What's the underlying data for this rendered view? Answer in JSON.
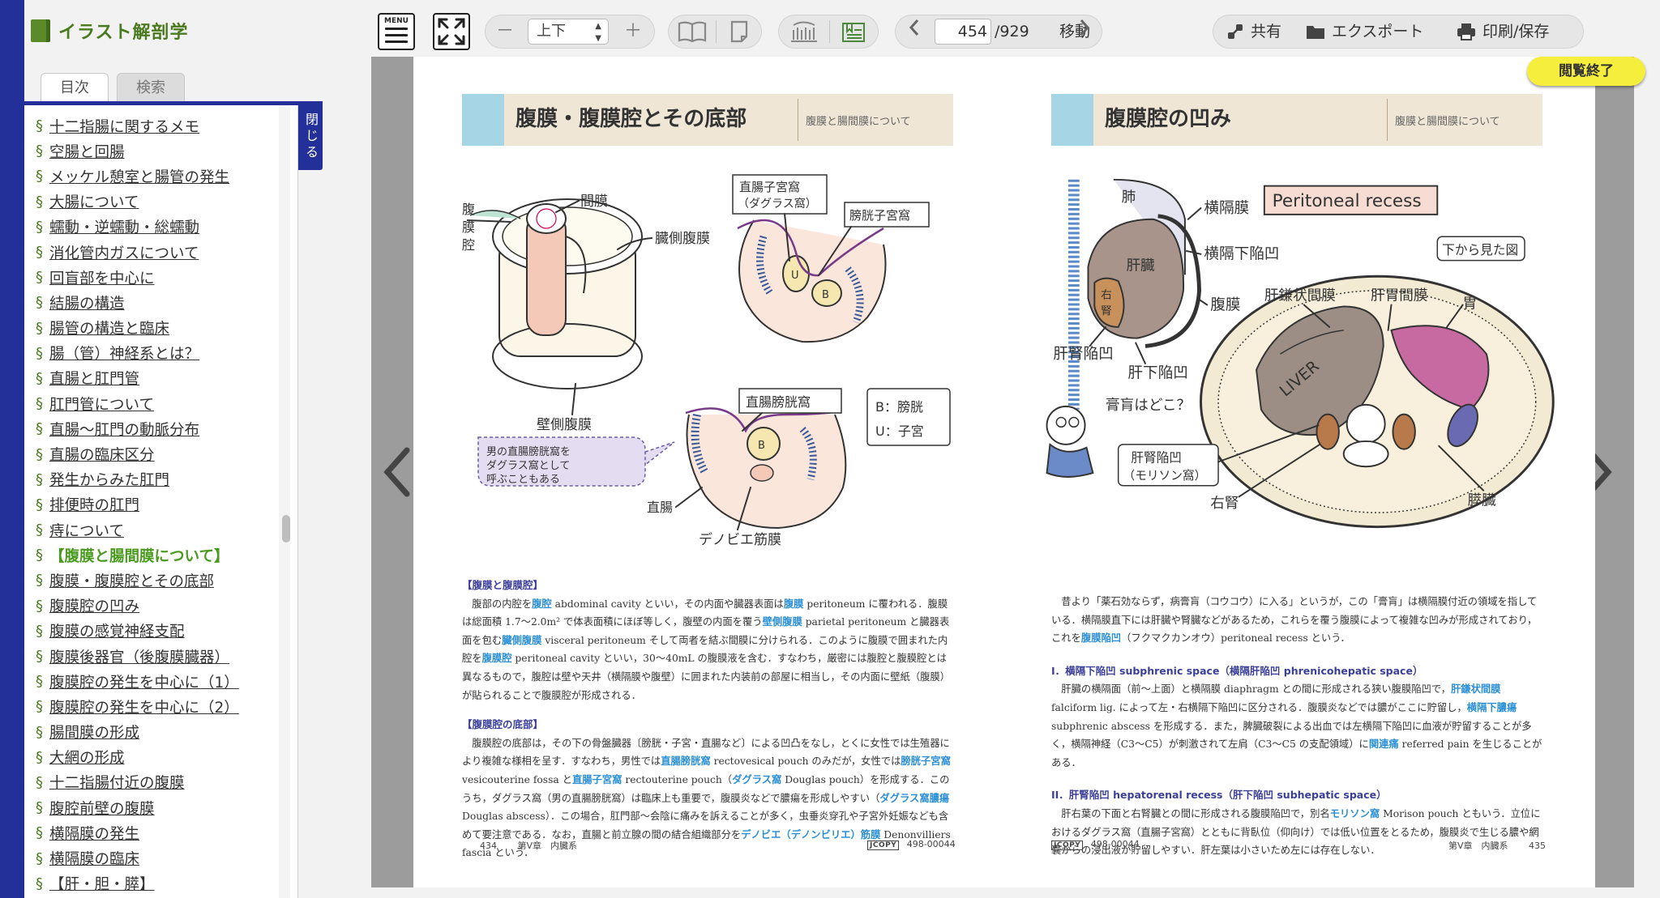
{
  "sidebar": {
    "app_title": "イラスト解剖学",
    "tabs": {
      "toc": "目次",
      "search": "検索"
    },
    "close_label": "閉じる",
    "toc_items": [
      "十二指腸に関するメモ",
      "空腸と回腸",
      "メッケル憩室と腸管の発生",
      "大腸について",
      "蠕動・逆蠕動・総蠕動",
      "消化管内ガスについて",
      "回盲部を中心に",
      "結腸の構造",
      "腸管の構造と臨床",
      "腸（管）神経系とは？",
      "直腸と肛門管",
      "肛門管について",
      "直腸～肛門の動脈分布",
      "直腸の臨床区分",
      "発生からみた肛門",
      "排便時の肛門",
      "痔について",
      "【腹膜と腸間膜について】",
      "腹膜・腹膜腔とその底部",
      "腹膜腔の凹み",
      "腹膜の感覚神経支配",
      "腹膜後器官（後腹膜臓器）",
      "腹膜腔の発生を中心に（1）",
      "腹膜腔の発生を中心に（2）",
      "腸間膜の形成",
      "大網の形成",
      "十二指腸付近の腹膜",
      "腹腔前壁の腹膜",
      "横隔膜の発生",
      "横隔膜の臨床",
      "【肝・胆・膵】"
    ],
    "active_index": 17,
    "section_mark": "§"
  },
  "toolbar": {
    "menu_label": "MENU",
    "direction_value": "上下",
    "minus_label": "－",
    "plus_label": "＋",
    "page_current": "454",
    "page_total": "/929",
    "goto_label": "移動",
    "share_label": "共有",
    "export_label": "エクスポート",
    "print_label": "印刷/保存"
  },
  "viewer": {
    "end_label": "閲覧終了"
  },
  "left_page": {
    "title": "腹膜・腹膜腔とその底部",
    "subtitle": "腹膜と腸間膜について",
    "labels": {
      "mesentery": "間膜",
      "cavity": "腹膜腔",
      "visceral": "臓側腹膜",
      "parietal": "壁側腹膜",
      "douglas": "直腸子宮窩（ダグラス窩）",
      "vesico_uterine": "膀胱子宮窩",
      "recto_vesical": "直腸膀胱窩",
      "legend_b": "B：膀胱",
      "legend_u": "U：子宮",
      "rectum": "直腸",
      "denon": "デノビエ筋膜",
      "bubble": "男の直腸膀胱窩をダグラス窩として呼ぶこともある",
      "u": "U",
      "b": "B"
    },
    "sections": [
      {
        "head": "【腹膜と腹膜腔】",
        "body": "腹部の内腔を腹腔 abdominal cavity といい，その内面や臓器表面は腹膜 peritoneum に覆われる．腹膜は総面積 1.7～2.0m² で体表面積にほぼ等しく，腹壁の内面を覆う壁側腹膜 parietal peritoneum と臓器表面を包む臓側腹膜 visceral peritoneum そして両者を結ぶ間膜に分けられる．このように腹膜で囲まれた内腔を腹膜腔 peritoneal cavity といい，30～40mL の腹膜液を含む．すなわち，厳密には腹腔と腹膜腔とは異なるもので，腹腔は壁や天井（横隔膜や腹壁）に囲まれた内装前の部屋に相当し，その内面に壁紙（腹膜）が貼られることで腹膜腔が形成される．"
      },
      {
        "head": "【腹膜腔の底部】",
        "body": "腹膜腔の底部は，その下の骨盤臓器〔膀胱・子宮・直腸など〕による凹凸をなし，とくに女性では生殖器により複雑な様相を呈す．すなわち，男性では直腸膀胱窩 rectovesical pouch のみだが，女性では膀胱子宮窩 vesicouterine fossa と直腸子宮窩 rectouterine pouch（ダグラス窩 Douglas pouch）を形成する．このうち，ダグラス窩（男の直腸膀胱窩）は臨床上も重要で，腹膜炎などで膿瘍を形成しやすい（ダグラス窩膿瘍 Douglas abscess）．この場合，肛門部～会陰に痛みを訴えることが多く，虫垂炎穿孔や子宮外妊娠なども含めて要注意である．なお，直腸と前立腺の間の結合組織部分をデノビエ（デノンビリエ）筋膜 Denonvilliers fascia という．"
      }
    ],
    "footer": {
      "page_no": "434",
      "chapter": "第V章　内臓系",
      "jcopy": "JCOPY",
      "code": "498-00044"
    }
  },
  "right_page": {
    "title": "腹膜腔の凹み",
    "subtitle": "腹膜と腸間膜について",
    "labels": {
      "lung": "肺",
      "diaphragm": "横隔膜",
      "subphrenic": "横隔下陥凹",
      "liver": "肝臓",
      "right_kidney": "右腎",
      "peritoneum": "腹膜",
      "hepatorenal": "肝腎陥凹",
      "subhepatic": "肝下陥凹",
      "recess_title": "Peritoneal recess",
      "view_from_below": "下から見た図",
      "falciform": "肝鎌状間膜",
      "hepatogastric": "肝胃間膜",
      "stomach": "胃",
      "liver_en": "LIVER",
      "question": "膏肓はどこ？",
      "morison": "肝腎陥凹（モリソン窩）",
      "kidney_r": "右腎",
      "pancreas": "膵臓"
    },
    "intro": "昔より「薬石効ならず，病膏肓（コウコウ）に入る」というが，この「膏肓」は横隔膜付近の領域を指している．横隔膜直下には肝臓や腎臓などがあるため，これらを覆う腹膜によって複雑な凹みが形成されており，これを腹膜陥凹（フクマクカンオウ）peritoneal recess という．",
    "sections": [
      {
        "head": "I．横隔下陥凹 subphrenic space（横隔肝陥凹 phrenicohepatic space）",
        "body": "肝臓の横隔面（前～上面）と横隔膜 diaphragm との間に形成される狭い腹膜陥凹で，肝鎌状間膜 falciform lig. によって左・右横隔下陥凹に区分される．腹膜炎などでは膿がここに貯留し，横隔下膿瘍 subphrenic abscess を形成する．また，脾臓破裂による出血では左横隔下陥凹に血液が貯留することが多く，横隔神経（C3～C5）が刺激されて左肩（C3～C5 の支配領域）に関連痛 referred pain を生じることがある．"
      },
      {
        "head": "II．肝腎陥凹 hepatorenal recess（肝下陥凹 subhepatic space）",
        "body": "肝右葉の下面と右腎臓との間に形成される腹膜陥凹で，別名モリソン窩 Morison pouch ともいう．立位におけるダグラス窩（直腸子宮窩）とともに背臥位（仰向け）では低い位置をとるため，腹膜炎で生じる膿や網嚢からの浸出液が貯留しやすい．肝左葉は小さいため左には存在しない．"
      }
    ],
    "footer": {
      "page_no": "435",
      "chapter": "第V章　内臓系",
      "jcopy": "JCOPY",
      "code": "498-00044"
    }
  },
  "colors": {
    "sidebar_blue": "#23309a",
    "toc_green": "#4a7a1e",
    "header_blue": "#a6d6e6",
    "header_beige": "#efe6d5",
    "highlight_blue": "#2b8fd6",
    "end_button_yellow": "#f6ee3c"
  },
  "icons": {
    "menu": "menu-icon",
    "fullscreen": "fullscreen-icon",
    "book_open": "open-book-icon",
    "single_page": "single-page-icon",
    "thumbnails": "thumbnails-icon",
    "bookmarks": "bookmark-list-icon",
    "prev": "chevron-left-icon",
    "next": "chevron-right-icon",
    "share": "share-icon",
    "export": "folder-icon",
    "print": "printer-icon"
  }
}
